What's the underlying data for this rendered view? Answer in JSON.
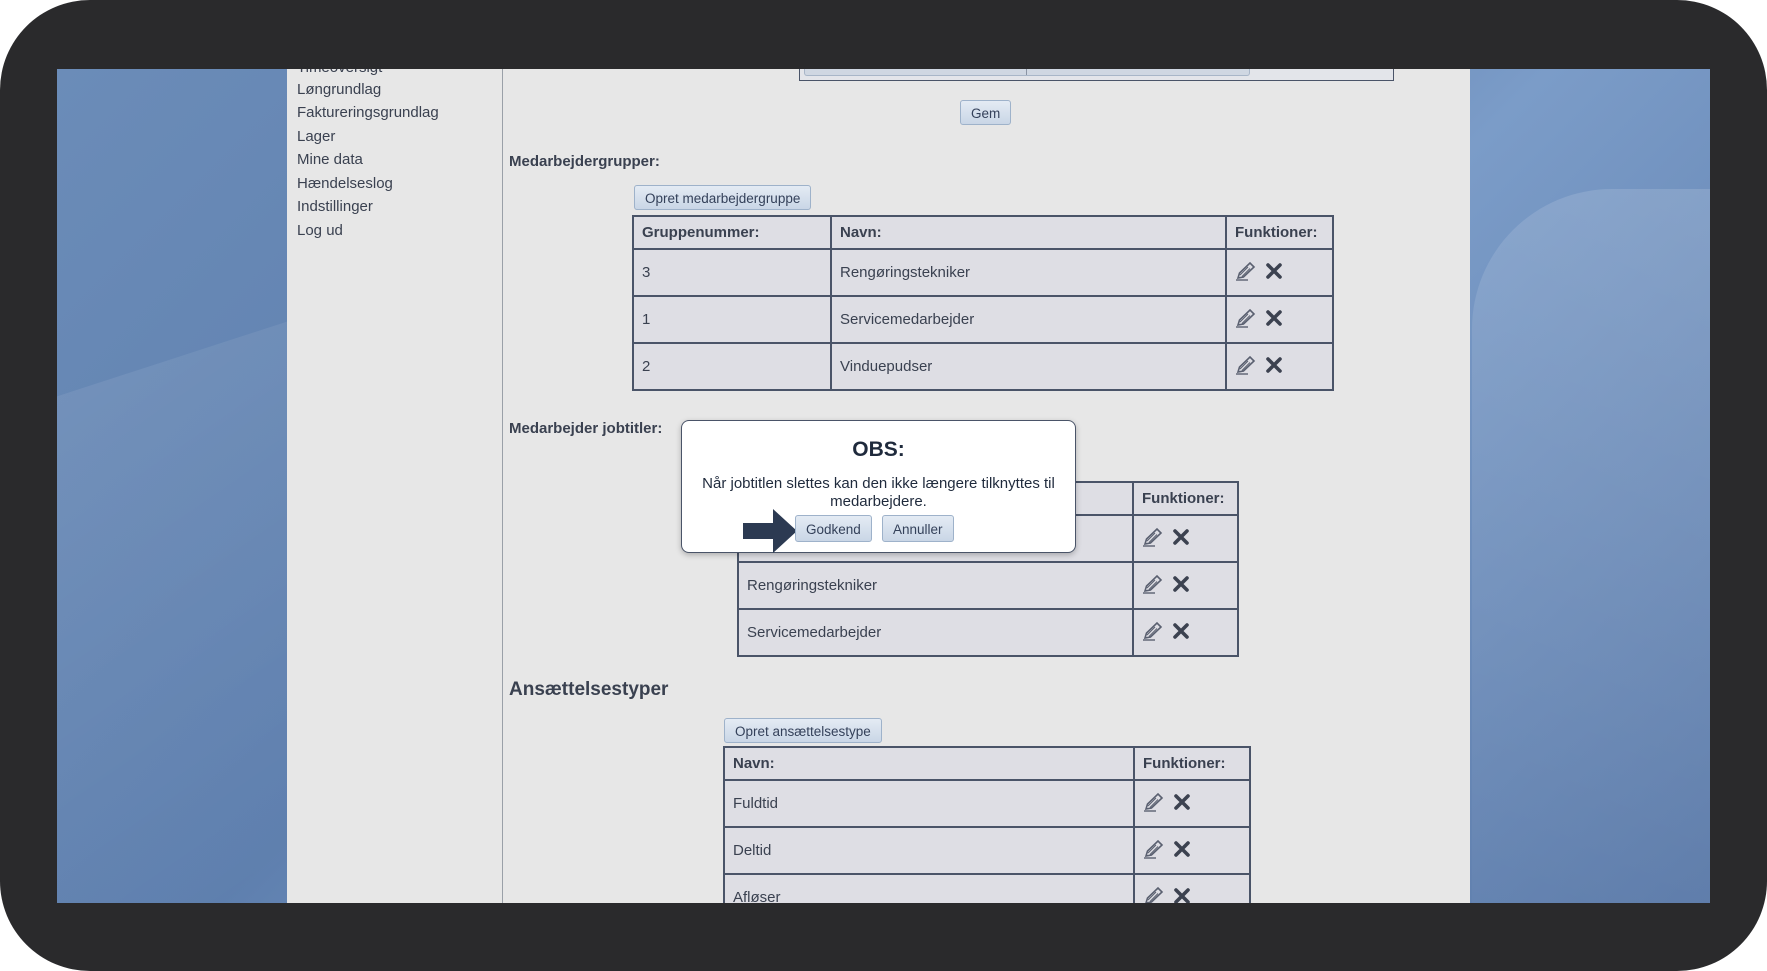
{
  "sidebar": {
    "items": [
      {
        "label": "Timeoversigt"
      },
      {
        "label": "Løngrundlag"
      },
      {
        "label": "Faktureringsgrundlag"
      },
      {
        "label": "Lager"
      },
      {
        "label": "Mine data"
      },
      {
        "label": "Hændelseslog"
      },
      {
        "label": "Indstillinger"
      },
      {
        "label": "Log ud"
      }
    ]
  },
  "save_button": "Gem",
  "groups": {
    "heading": "Medarbejdergrupper:",
    "create_button": "Opret medarbejdergruppe",
    "columns": [
      "Gruppenummer:",
      "Navn:",
      "Funktioner:"
    ],
    "rows": [
      {
        "number": "3",
        "name": "Rengøringstekniker"
      },
      {
        "number": "1",
        "name": "Servicemedarbejder"
      },
      {
        "number": "2",
        "name": "Vinduepudser"
      }
    ]
  },
  "jobtitles": {
    "heading": "Medarbejder jobtitler:",
    "columns": [
      "Funktioner:"
    ],
    "rows": [
      {
        "name": ""
      },
      {
        "name": "Rengøringstekniker"
      },
      {
        "name": "Servicemedarbejder"
      }
    ]
  },
  "employment_types": {
    "heading": "Ansættelsestyper",
    "create_button": "Opret ansættelsestype",
    "columns": [
      "Navn:",
      "Funktioner:"
    ],
    "rows": [
      {
        "name": "Fuldtid"
      },
      {
        "name": "Deltid"
      },
      {
        "name": "Afløser"
      }
    ]
  },
  "dialog": {
    "title": "OBS:",
    "message": "Når jobtitlen slettes kan den ikke længere tilknyttes til medarbejdere.",
    "confirm_label": "Godkend",
    "cancel_label": "Annuller"
  },
  "colors": {
    "desktop": "#6b8cb8",
    "page_bg": "#e7e7e7",
    "table_border": "#4a5468",
    "arrow": "#2c3a52"
  },
  "icons": {
    "edit": "pencil-icon",
    "delete": "close-icon"
  }
}
